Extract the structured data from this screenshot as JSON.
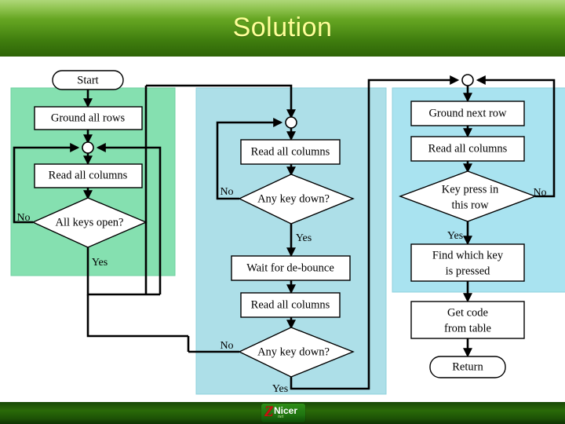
{
  "slide": {
    "title": "Solution",
    "title_color": "#ffff99",
    "header_gradient_top": "#8cc63e",
    "header_gradient_bottom": "#2e6408"
  },
  "footer": {
    "logo_letter": "Z",
    "logo_word": "Nicer",
    "logo_sub": "net"
  },
  "panels": {
    "left": {
      "name": "green-panel",
      "color": "#85e0b0"
    },
    "middle": {
      "name": "cyan-panel-middle",
      "color": "#addfe8"
    },
    "right": {
      "name": "cyan-panel-right",
      "color": "#a9e3f0"
    }
  },
  "flowchart": {
    "type": "flowchart",
    "nodes": {
      "start": {
        "label": "Start",
        "shape": "terminator"
      },
      "ground_all_rows": {
        "label": "Ground all rows",
        "shape": "process"
      },
      "read_all_columns_left": {
        "label": "Read all columns",
        "shape": "process"
      },
      "all_keys_open": {
        "label": "All keys open?",
        "shape": "decision"
      },
      "read_all_columns_mid_top": {
        "label": "Read all columns",
        "shape": "process"
      },
      "any_key_down_top": {
        "label": "Any key down?",
        "shape": "decision"
      },
      "wait_for_debounce": {
        "label": "Wait for de-bounce",
        "shape": "process"
      },
      "read_all_columns_mid_bottom": {
        "label": "Read all columns",
        "shape": "process"
      },
      "any_key_down_bottom": {
        "label": "Any key down?",
        "shape": "decision"
      },
      "ground_next_row": {
        "label": "Ground next row",
        "shape": "process"
      },
      "read_all_columns_right": {
        "label": "Read all columns",
        "shape": "process"
      },
      "key_press_in_this_row": {
        "label_line1": "Key press in",
        "label_line2": "this row",
        "shape": "decision"
      },
      "find_which_key": {
        "label_line1": "Find which key",
        "label_line2": "is pressed",
        "shape": "process"
      },
      "get_code_from_table": {
        "label_line1": "Get code",
        "label_line2": "from table",
        "shape": "process"
      },
      "return": {
        "label": "Return",
        "shape": "terminator"
      }
    },
    "edge_labels": {
      "all_keys_open_no": "No",
      "all_keys_open_yes": "Yes",
      "any_key_down_top_no": "No",
      "any_key_down_top_yes": "Yes",
      "any_key_down_bottom_no": "No",
      "any_key_down_bottom_yes": "Yes",
      "key_press_no": "No",
      "key_press_yes": "Yes"
    }
  }
}
